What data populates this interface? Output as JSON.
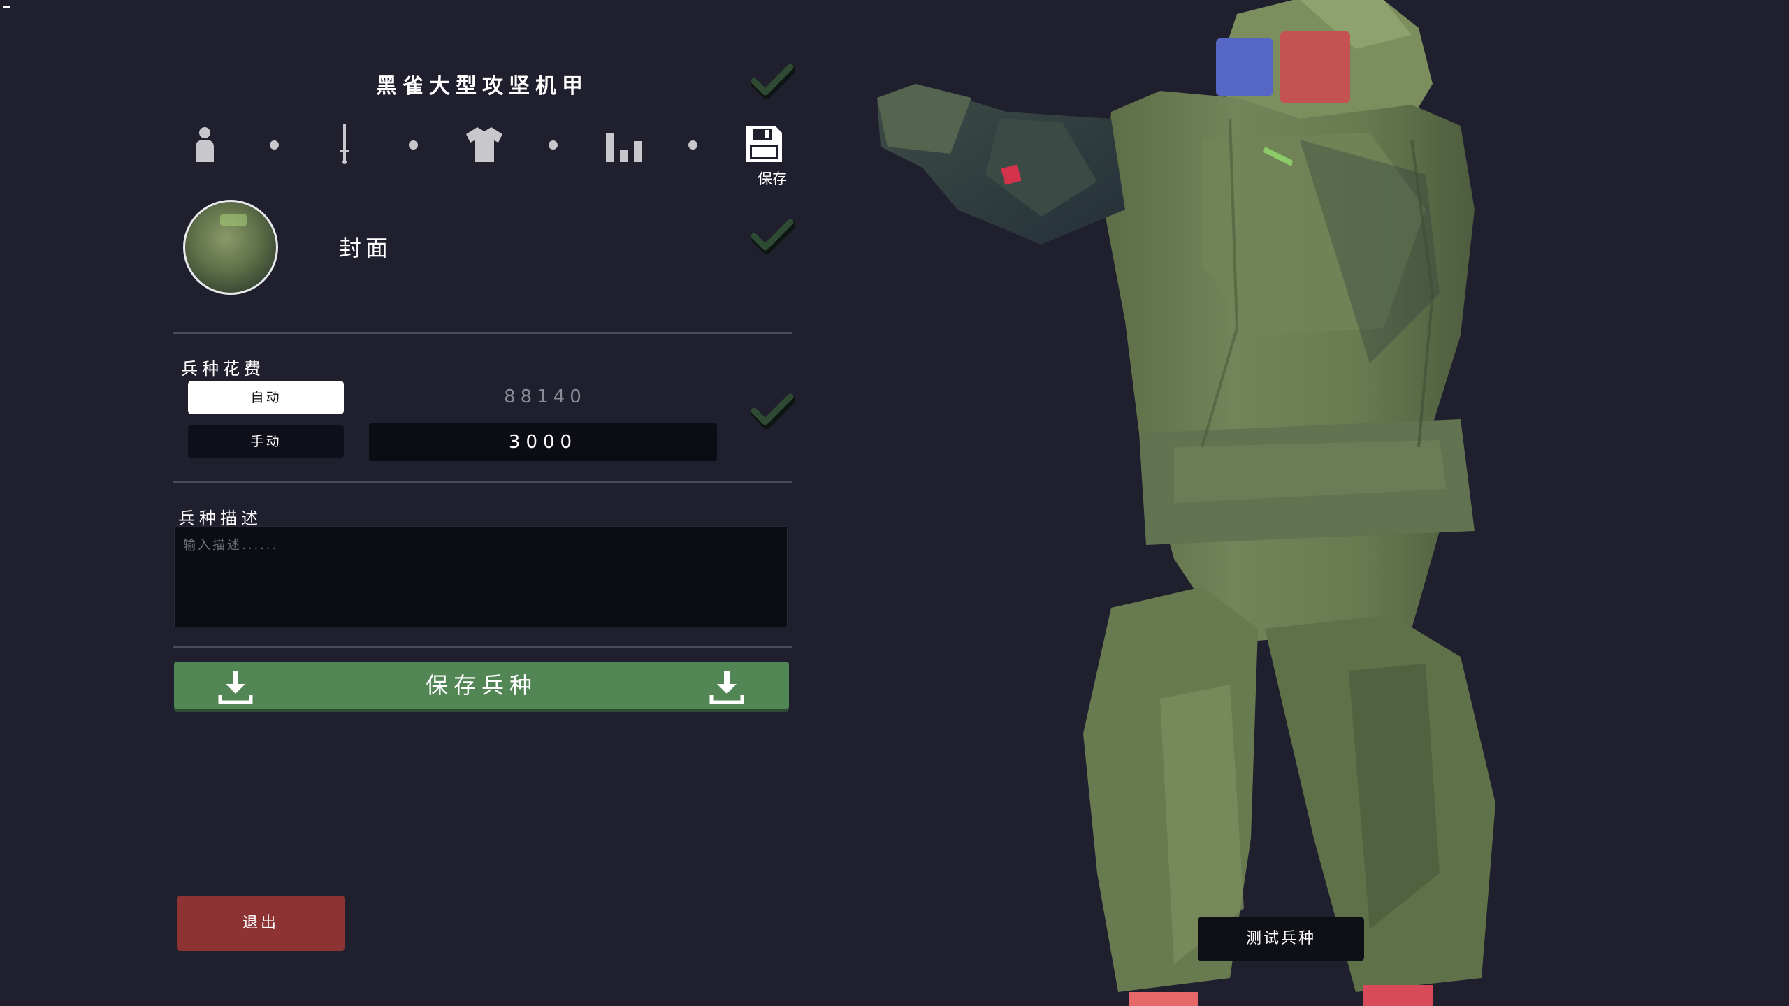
{
  "unit": {
    "title": "黑雀大型攻坚机甲"
  },
  "steps": {
    "items": [
      {
        "icon": "person-icon"
      },
      {
        "icon": "sword-icon"
      },
      {
        "icon": "shirt-icon"
      },
      {
        "icon": "stats-icon"
      },
      {
        "icon": "floppy-disk-icon"
      }
    ],
    "save_label": "保存"
  },
  "cover": {
    "label": "封面"
  },
  "cost": {
    "label": "兵种花费",
    "auto_label": "自动",
    "manual_label": "手动",
    "auto_value": "88140",
    "manual_value": "3000"
  },
  "description": {
    "label": "兵种描述",
    "placeholder": "输入描述......",
    "value": ""
  },
  "actions": {
    "save_unit_label": "保存兵种",
    "exit_label": "退出",
    "test_label": "测试兵种"
  },
  "colors": {
    "background": "#1f1f2d",
    "save_green": "#528755",
    "exit_red": "#8e3333",
    "check_green": "#2f4a33",
    "mech_green": "#6b7d52",
    "team_blue": "#5666c4",
    "team_red": "#c45252"
  }
}
